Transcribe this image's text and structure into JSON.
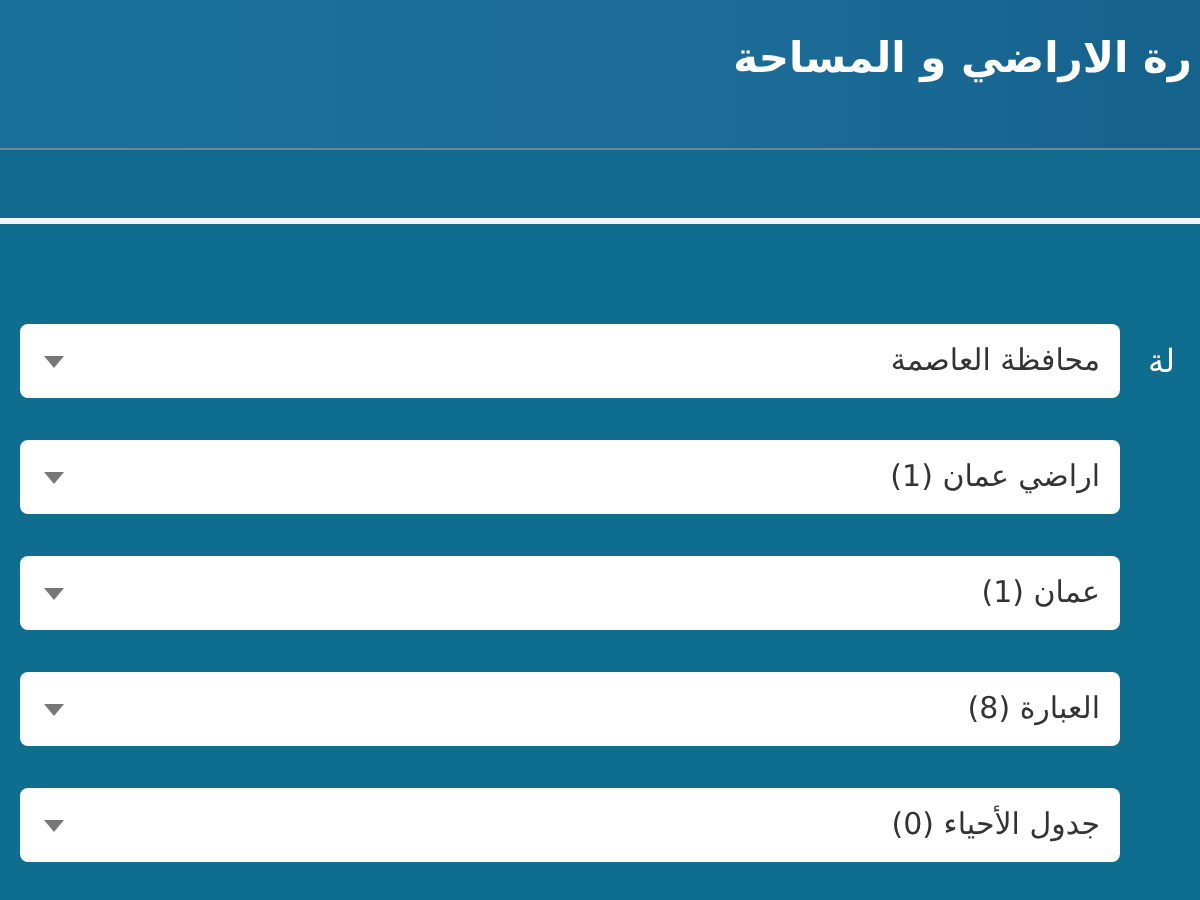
{
  "header": {
    "title": "رة الاراضي و المساحة"
  },
  "form": {
    "label": "لة",
    "dropdowns": [
      {
        "value": "محافظة العاصمة"
      },
      {
        "value": "اراضي عمان (1)"
      },
      {
        "value": "عمان (1)"
      },
      {
        "value": "العبارة (8)"
      },
      {
        "value": "جدول الأحياء (0)"
      }
    ]
  }
}
